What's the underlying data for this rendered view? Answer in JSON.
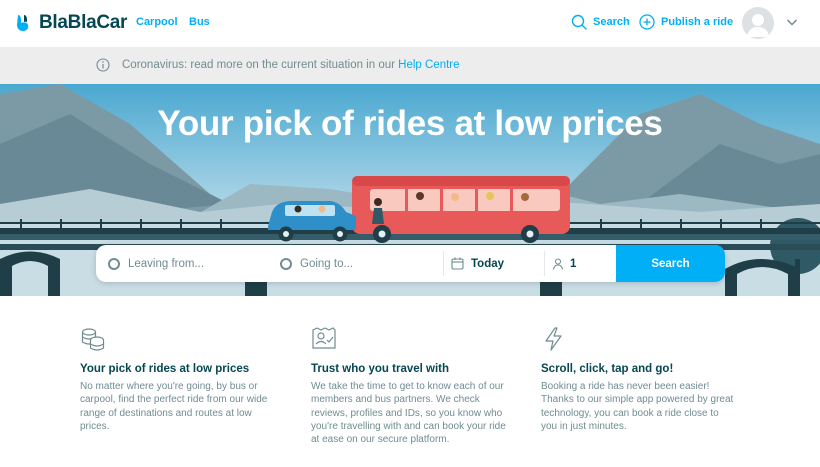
{
  "header": {
    "logo_text": "BlaBlaCar",
    "nav": [
      {
        "label": "Carpool"
      },
      {
        "label": "Bus"
      }
    ],
    "search_label": "Search",
    "publish_label": "Publish a ride",
    "icons": [
      "search-icon",
      "plus-circle-icon",
      "avatar",
      "chevron-down-icon"
    ]
  },
  "banner": {
    "text": "Coronavirus: read more on the current situation in our ",
    "link": "Help Centre"
  },
  "hero": {
    "title": "Your pick of rides at low prices"
  },
  "search": {
    "leaving_placeholder": "Leaving from...",
    "going_placeholder": "Going to...",
    "date": "Today",
    "passengers": "1",
    "button": "Search"
  },
  "features": [
    {
      "icon": "coins-icon",
      "title": "Your pick of rides at low prices",
      "body": "No matter where you're going, by bus or carpool, find the perfect ride from our wide range of destinations and routes at low prices."
    },
    {
      "icon": "id-card-icon",
      "title": "Trust who you travel with",
      "body": "We take the time to get to know each of our members and bus partners. We check reviews, profiles and IDs, so you know who you're travelling with and can book your ride at ease on our secure platform."
    },
    {
      "icon": "lightning-icon",
      "title": "Scroll, click, tap and go!",
      "body": "Booking a ride has never been easier! Thanks to our simple app powered by great technology, you can book a ride close to you in just minutes."
    }
  ],
  "colors": {
    "brand_blue": "#00aff5",
    "text_dark": "#054752",
    "text_muted": "#708c91",
    "banner_bg": "#ededed"
  }
}
